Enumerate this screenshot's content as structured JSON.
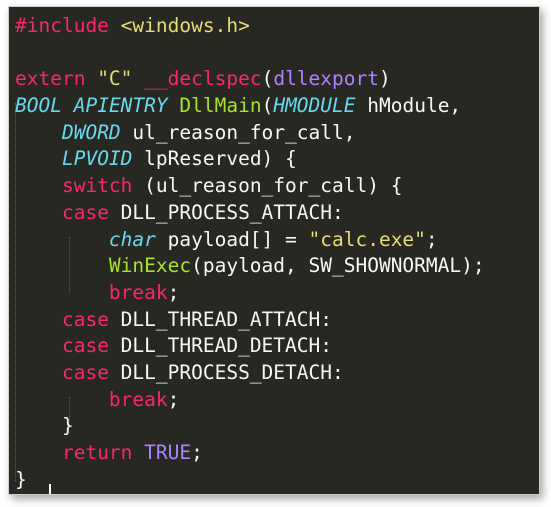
{
  "editor": {
    "theme_colors": {
      "background": "#272822",
      "foreground": "#f8f8f2",
      "keyword": "#f92672",
      "string": "#e6db74",
      "function": "#a6e22e",
      "type": "#66d9ef",
      "constant": "#ae81ff"
    },
    "lines": [
      [
        {
          "t": "#include ",
          "c": "preproc"
        },
        {
          "t": "<windows.h>",
          "c": "str"
        }
      ],
      [],
      [
        {
          "t": "extern ",
          "c": "kw"
        },
        {
          "t": "\"C\"",
          "c": "str"
        },
        {
          "t": " ",
          "c": "plain"
        },
        {
          "t": "__declspec",
          "c": "kw"
        },
        {
          "t": "(",
          "c": "plain"
        },
        {
          "t": "dllexport",
          "c": "const"
        },
        {
          "t": ")",
          "c": "plain"
        }
      ],
      [
        {
          "t": "BOOL",
          "c": "type"
        },
        {
          "t": " ",
          "c": "plain"
        },
        {
          "t": "APIENTRY",
          "c": "type"
        },
        {
          "t": " ",
          "c": "plain"
        },
        {
          "t": "DllMain",
          "c": "func"
        },
        {
          "t": "(",
          "c": "plain"
        },
        {
          "t": "HMODULE",
          "c": "type"
        },
        {
          "t": " hModule,",
          "c": "plain"
        }
      ],
      [
        {
          "t": "    ",
          "c": "plain"
        },
        {
          "t": "DWORD",
          "c": "type"
        },
        {
          "t": " ul_reason_for_call,",
          "c": "plain"
        }
      ],
      [
        {
          "t": "    ",
          "c": "plain"
        },
        {
          "t": "LPVOID",
          "c": "type"
        },
        {
          "t": " lpReserved) {",
          "c": "plain"
        }
      ],
      [
        {
          "t": "    ",
          "c": "plain"
        },
        {
          "t": "switch",
          "c": "kw"
        },
        {
          "t": " (ul_reason_for_call) {",
          "c": "plain"
        }
      ],
      [
        {
          "t": "    ",
          "c": "plain"
        },
        {
          "t": "case",
          "c": "kw"
        },
        {
          "t": " DLL_PROCESS_ATTACH:",
          "c": "plain"
        }
      ],
      [
        {
          "t": "        ",
          "c": "plain"
        },
        {
          "t": "char",
          "c": "type"
        },
        {
          "t": " payload[] = ",
          "c": "plain"
        },
        {
          "t": "\"calc.exe\"",
          "c": "str"
        },
        {
          "t": ";",
          "c": "plain"
        }
      ],
      [
        {
          "t": "        ",
          "c": "plain"
        },
        {
          "t": "WinExec",
          "c": "func"
        },
        {
          "t": "(payload, SW_SHOWNORMAL);",
          "c": "plain"
        }
      ],
      [
        {
          "t": "        ",
          "c": "plain"
        },
        {
          "t": "break",
          "c": "kw"
        },
        {
          "t": ";",
          "c": "plain"
        }
      ],
      [
        {
          "t": "    ",
          "c": "plain"
        },
        {
          "t": "case",
          "c": "kw"
        },
        {
          "t": " DLL_THREAD_ATTACH:",
          "c": "plain"
        }
      ],
      [
        {
          "t": "    ",
          "c": "plain"
        },
        {
          "t": "case",
          "c": "kw"
        },
        {
          "t": " DLL_THREAD_DETACH:",
          "c": "plain"
        }
      ],
      [
        {
          "t": "    ",
          "c": "plain"
        },
        {
          "t": "case",
          "c": "kw"
        },
        {
          "t": " DLL_PROCESS_DETACH:",
          "c": "plain"
        }
      ],
      [
        {
          "t": "        ",
          "c": "plain"
        },
        {
          "t": "break",
          "c": "kw"
        },
        {
          "t": ";",
          "c": "plain"
        }
      ],
      [
        {
          "t": "    }",
          "c": "plain"
        }
      ],
      [
        {
          "t": "    ",
          "c": "plain"
        },
        {
          "t": "return",
          "c": "kw"
        },
        {
          "t": " ",
          "c": "plain"
        },
        {
          "t": "TRUE",
          "c": "const"
        },
        {
          "t": ";",
          "c": "plain"
        }
      ],
      [
        {
          "t": "}",
          "c": "plain"
        }
      ]
    ]
  }
}
